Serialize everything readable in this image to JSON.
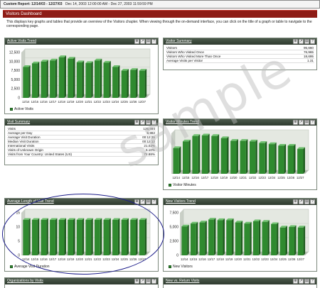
{
  "report": {
    "label": "Custom Report: 12/14/03 - 12/27/03",
    "range": "Dec 14, 2003 12:00:00 AM - Dec 27, 2003 11:59:59 PM"
  },
  "dashboard": {
    "title": "Visitors Dashboard",
    "description": "This displays key graphs and tables that provide an overview of the Visitors chapter. When viewing through the on-demand interface, you can click on the title of a graph or table to navigate to the corresponding page."
  },
  "icons": [
    "zoom-icon",
    "export-icon",
    "print-icon",
    "help-icon"
  ],
  "panels": {
    "active_visits_trend": {
      "title": "Active Visits Trend",
      "legend": "Active Visits"
    },
    "visitor_summary": {
      "title": "Visitor Summary",
      "rows": [
        {
          "label": "Visitors",
          "value": "95,660"
        },
        {
          "label": "Visitors Who Visited Once",
          "value": "76,965"
        },
        {
          "label": "Visitors Who Visited More Than Once",
          "value": "18,695"
        },
        {
          "label": "Average Visits per Visitor",
          "value": "1.31"
        }
      ]
    },
    "visit_summary": {
      "title": "Visit Summary",
      "rows": [
        {
          "label": "Visits",
          "value": "125,694"
        },
        {
          "label": "Average per Day",
          "value": "8,982"
        },
        {
          "label": "Average Visit Duration",
          "value": "00:12:25"
        },
        {
          "label": "Median Visit Duration",
          "value": "00:12:13"
        },
        {
          "label": "International Visits",
          "value": "21.02%"
        },
        {
          "label": "Visits of Unknown Origin",
          "value": "6.10%"
        },
        {
          "label": "Visits from Your Country: United States (US)",
          "value": "72.88%"
        }
      ]
    },
    "visitor_minutes_trend": {
      "title": "Visitor Minutes Trend",
      "legend": "Visitor Minutes"
    },
    "avg_length_trend": {
      "title": "Average Length of Visit Trend",
      "legend": "Average Visit Duration"
    },
    "new_visitors_trend": {
      "title": "New Visitors Trend",
      "legend": "New Visitors"
    },
    "organizations_by_visits": {
      "title": "Organizations by Visits"
    },
    "new_vs_return": {
      "title": "New vs. Return Visits"
    }
  },
  "watermark": "sample",
  "chart_data": [
    {
      "type": "bar",
      "categories": [
        "12/14",
        "12/15",
        "12/16",
        "12/17",
        "12/18",
        "12/19",
        "12/20",
        "12/21",
        "12/22",
        "12/23",
        "12/24",
        "12/25",
        "12/26",
        "12/27"
      ],
      "series": [
        {
          "name": "Active Visits",
          "values": [
            8500,
            9500,
            10000,
            10300,
            11200,
            10800,
            9800,
            9600,
            10300,
            9700,
            8500,
            7500,
            7700,
            7500
          ]
        }
      ],
      "ylim": [
        0,
        12500
      ],
      "yticks": [
        "12,500",
        "10,000",
        "7,500",
        "5,000",
        "2,500",
        "0"
      ],
      "ytick_values": [
        12500,
        10000,
        7500,
        5000,
        2500,
        0
      ],
      "color": "#2f8a2f"
    },
    {
      "type": "bar",
      "categories": [
        "12/14",
        "12/15",
        "12/16",
        "12/17",
        "12/18",
        "12/19",
        "12/20",
        "12/21",
        "12/22",
        "12/23",
        "12/24",
        "12/25",
        "12/26",
        "12/27"
      ],
      "series": [
        {
          "name": "Visitor Minutes",
          "values": [
            95,
            120,
            140,
            142,
            140,
            132,
            122,
            122,
            120,
            114,
            110,
            104,
            104,
            92
          ]
        }
      ],
      "ylim": [
        0,
        150
      ],
      "yticks": [],
      "ytick_values": [],
      "color": "#2f8a2f"
    },
    {
      "type": "bar",
      "categories": [
        "12/14",
        "12/15",
        "12/16",
        "12/17",
        "12/18",
        "12/19",
        "12/20",
        "12/21",
        "12/22",
        "12/23",
        "12/24",
        "12/25",
        "12/26",
        "12/27"
      ],
      "series": [
        {
          "name": "Average Visit Duration",
          "values": [
            12.5,
            12.5,
            12.5,
            12.5,
            12.5,
            12.5,
            12.5,
            12.5,
            12.5,
            12.5,
            12.5,
            12.5,
            12.5,
            12.5
          ]
        }
      ],
      "ylim": [
        0,
        15
      ],
      "yticks": [
        "15",
        "10",
        "5",
        "0"
      ],
      "ytick_values": [
        15,
        10,
        5,
        0
      ],
      "color": "#2f8a2f"
    },
    {
      "type": "bar",
      "categories": [
        "12/14",
        "12/15",
        "12/16",
        "12/17",
        "12/18",
        "12/19",
        "12/20",
        "12/21",
        "12/22",
        "12/23",
        "12/24",
        "12/25",
        "12/26",
        "12/27"
      ],
      "series": [
        {
          "name": "New Visitors",
          "values": [
            5100,
            5600,
            5800,
            6300,
            6200,
            6200,
            5800,
            5600,
            6000,
            5900,
            5500,
            4900,
            5000,
            4900
          ]
        }
      ],
      "ylim": [
        0,
        7500
      ],
      "yticks": [
        "7,500",
        "5,000",
        "2,500",
        "0"
      ],
      "ytick_values": [
        7500,
        5000,
        2500,
        0
      ],
      "color": "#2f8a2f"
    }
  ]
}
